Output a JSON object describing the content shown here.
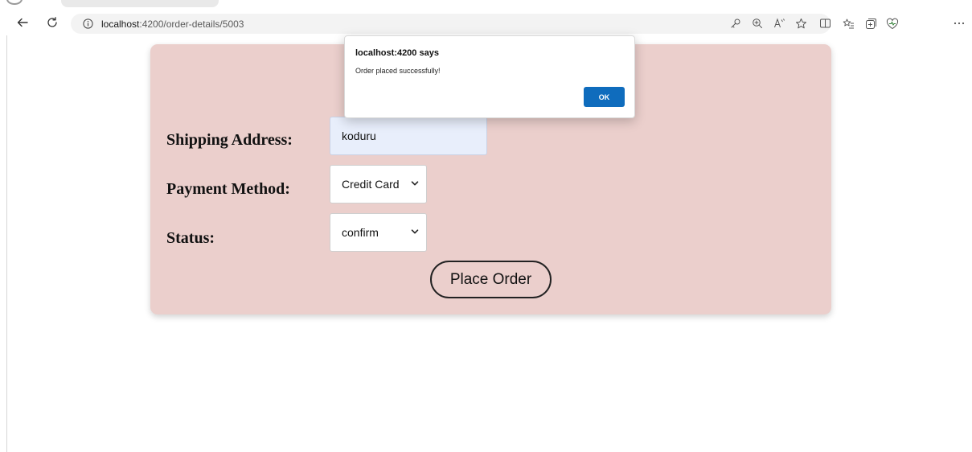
{
  "browser": {
    "url_host": "localhost",
    "url_rest": ":4200/order-details/5003"
  },
  "form": {
    "shipping_label": "Shipping Address:",
    "shipping_value": "koduru",
    "payment_label": "Payment Method:",
    "payment_value": "Credit Card",
    "status_label": "Status:",
    "status_value": "confirm",
    "place_order_label": "Place Order"
  },
  "dialog": {
    "title": "localhost:4200 says",
    "message": "Order placed successfully!",
    "ok_label": "OK"
  },
  "colors": {
    "card_background": "#ebcfcc",
    "dialog_button": "#0f6cbd"
  },
  "icons": {
    "toolbar": [
      "back-arrow-icon",
      "refresh-icon",
      "info-icon",
      "key-icon",
      "zoom-icon",
      "read-aloud-icon",
      "favorite-star-icon",
      "split-screen-icon",
      "favorites-icon",
      "collections-icon",
      "browser-essentials-icon",
      "more-icon"
    ],
    "select": "chevron-down-icon"
  }
}
